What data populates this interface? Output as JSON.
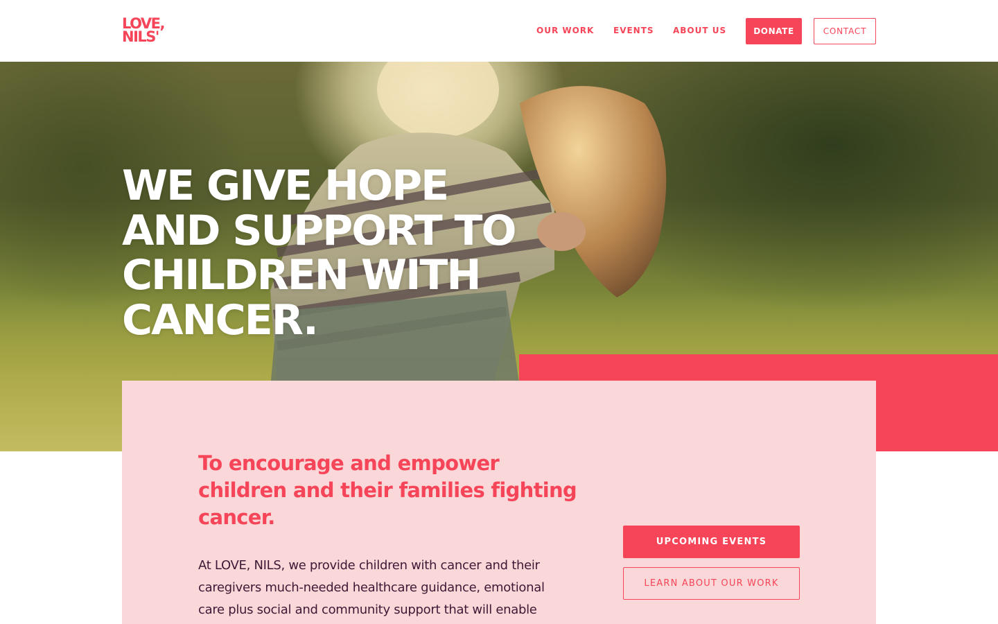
{
  "brand": {
    "logo_line1": "LOVE,",
    "logo_line2": "NILS'",
    "accent_color": "#f64458",
    "card_color": "#fad7d8",
    "text_color": "#3c1a36"
  },
  "nav": {
    "links": [
      {
        "label": "OUR WORK"
      },
      {
        "label": "EVENTS"
      },
      {
        "label": "ABOUT US"
      }
    ],
    "donate_label": "DONATE",
    "contact_label": "CONTACT"
  },
  "hero": {
    "title_lines": [
      "WE GIVE HOPE",
      "AND SUPPORT TO",
      "CHILDREN WITH",
      "CANCER."
    ]
  },
  "mission": {
    "heading_lines": [
      "To encourage and empower",
      "children and their families fighting",
      "cancer."
    ],
    "body_lines": [
      "At LOVE, NILS, we provide children with cancer and their",
      "caregivers much-needed healthcare guidance, emotional",
      "care plus social and community support that will enable"
    ],
    "primary_button": "UPCOMING EVENTS",
    "secondary_button": "LEARN ABOUT OUR WORK"
  }
}
